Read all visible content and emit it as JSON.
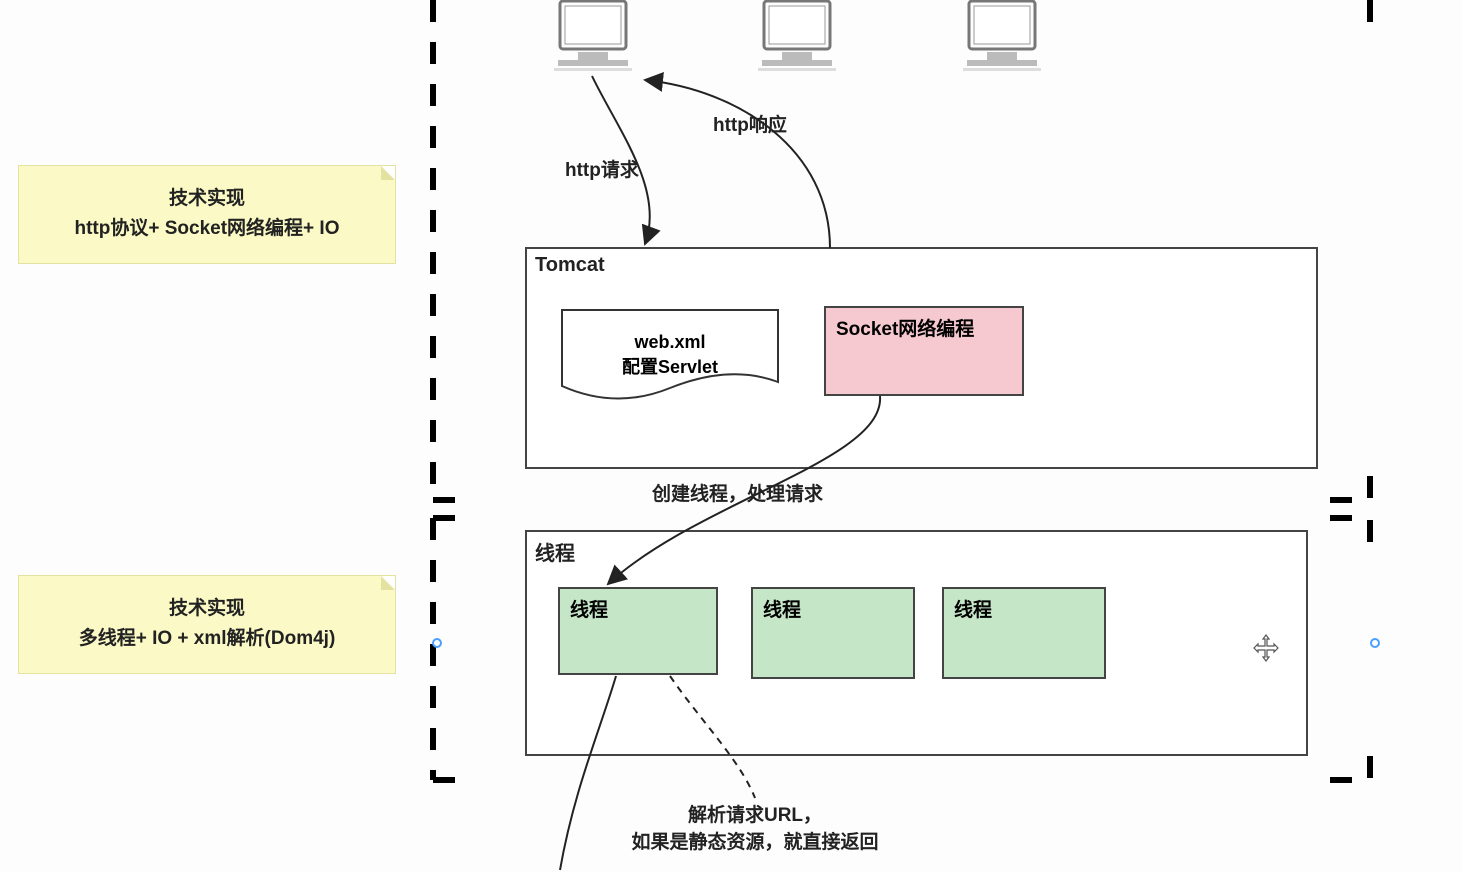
{
  "notes": {
    "top": {
      "title": "技术实现",
      "line2": "http协议+ Socket网络编程+ IO"
    },
    "bottom": {
      "title": "技术实现",
      "line2": "多线程+ IO + xml解析(Dom4j)"
    }
  },
  "labels": {
    "httpRequest": "http请求",
    "httpResponse": "http响应",
    "createThread": "创建线程，处理请求",
    "parseUrl1": "解析请求URL，",
    "parseUrl2": "如果是静态资源，就直接返回"
  },
  "containers": {
    "tomcat": {
      "label": "Tomcat"
    },
    "threadPool": {
      "label": "线程"
    }
  },
  "webxml": {
    "l1": "web.xml",
    "l2": "配置Servlet"
  },
  "socketBox": {
    "label": "Socket网络编程"
  },
  "threads": {
    "t1": "线程",
    "t2": "线程",
    "t3": "线程"
  }
}
